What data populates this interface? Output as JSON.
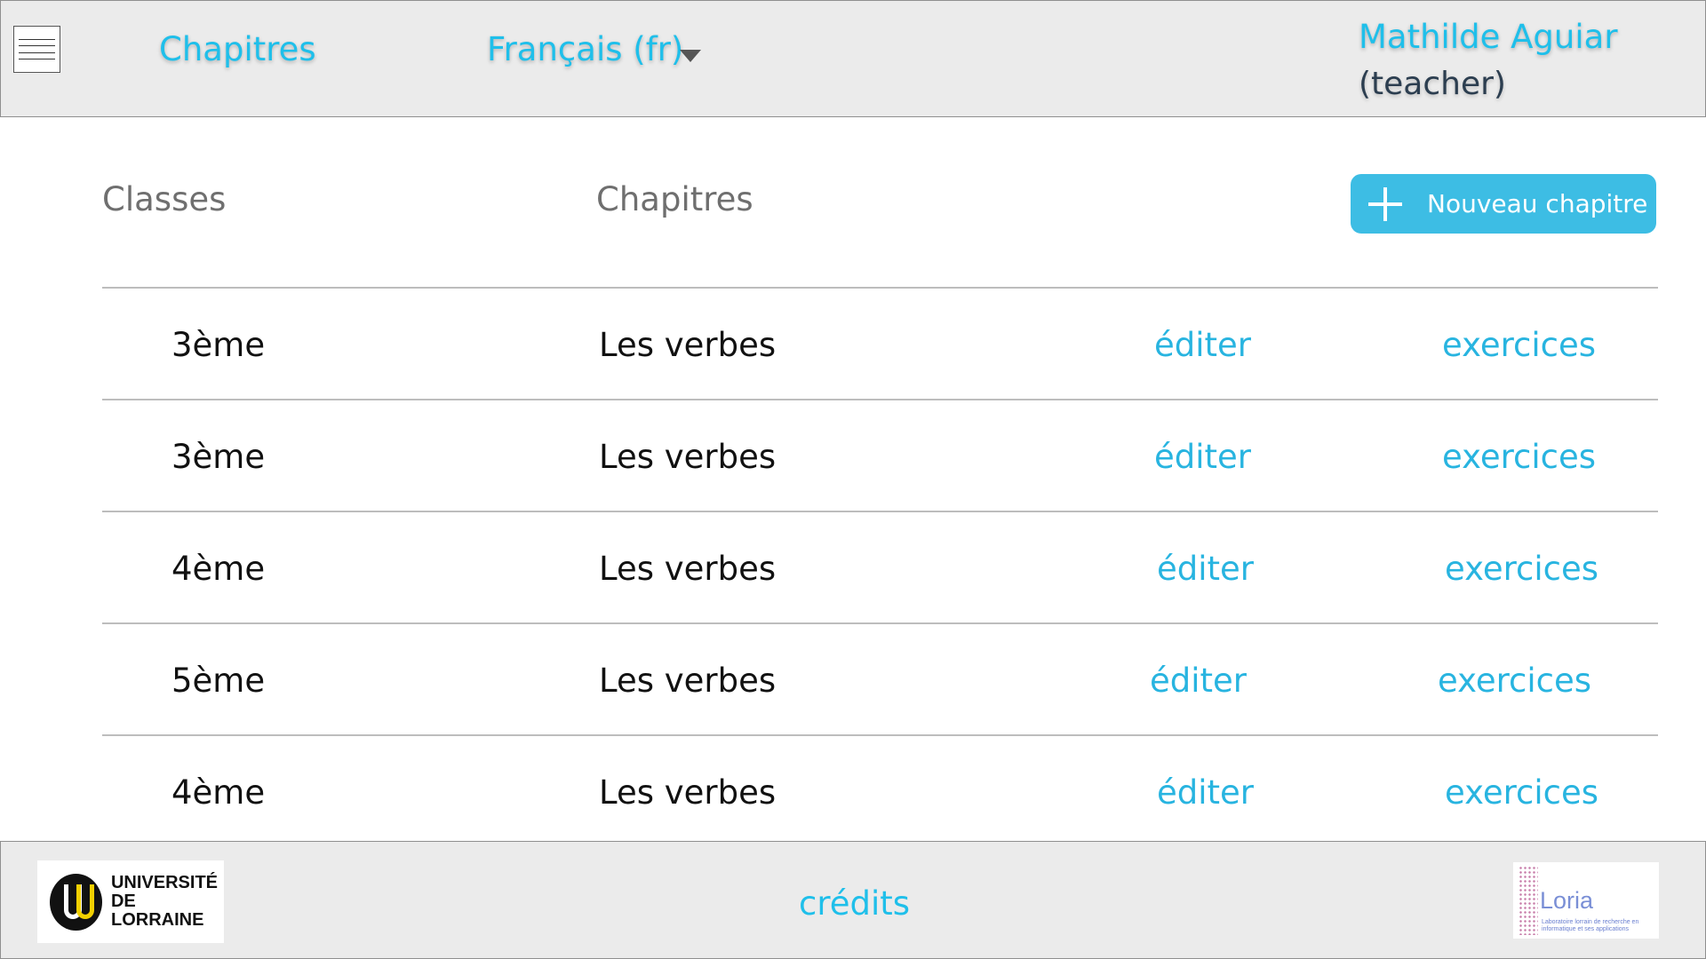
{
  "header": {
    "nav_chapitres": "Chapitres",
    "language": "Français (fr)",
    "user_name": "Mathilde Aguiar",
    "user_role": "(teacher)"
  },
  "main": {
    "col_classes": "Classes",
    "col_chapitres": "Chapitres",
    "new_button_label": "Nouveau chapitre",
    "rows": [
      {
        "classe": "3ème",
        "chapitre": "Les verbes",
        "edit": "éditer",
        "exercices": "exercices"
      },
      {
        "classe": "3ème",
        "chapitre": "Les verbes",
        "edit": "éditer",
        "exercices": "exercices"
      },
      {
        "classe": "4ème",
        "chapitre": "Les verbes",
        "edit": "éditer",
        "exercices": "exercices"
      },
      {
        "classe": "5ème",
        "chapitre": "Les verbes",
        "edit": "éditer",
        "exercices": "exercices"
      },
      {
        "classe": "4ème",
        "chapitre": "Les verbes",
        "edit": "éditer",
        "exercices": "exercices"
      }
    ]
  },
  "footer": {
    "univ_logo_text_1": "UNIVERSITÉ",
    "univ_logo_text_2": "DE LORRAINE",
    "credits": "crédits",
    "loria_word": "Loria",
    "loria_subtitle": "Laboratoire lorrain de recherche en informatique et ses applications"
  },
  "colors": {
    "accent": "#1fbfea",
    "button": "#3dbde4",
    "bar_background": "#ebebeb"
  }
}
